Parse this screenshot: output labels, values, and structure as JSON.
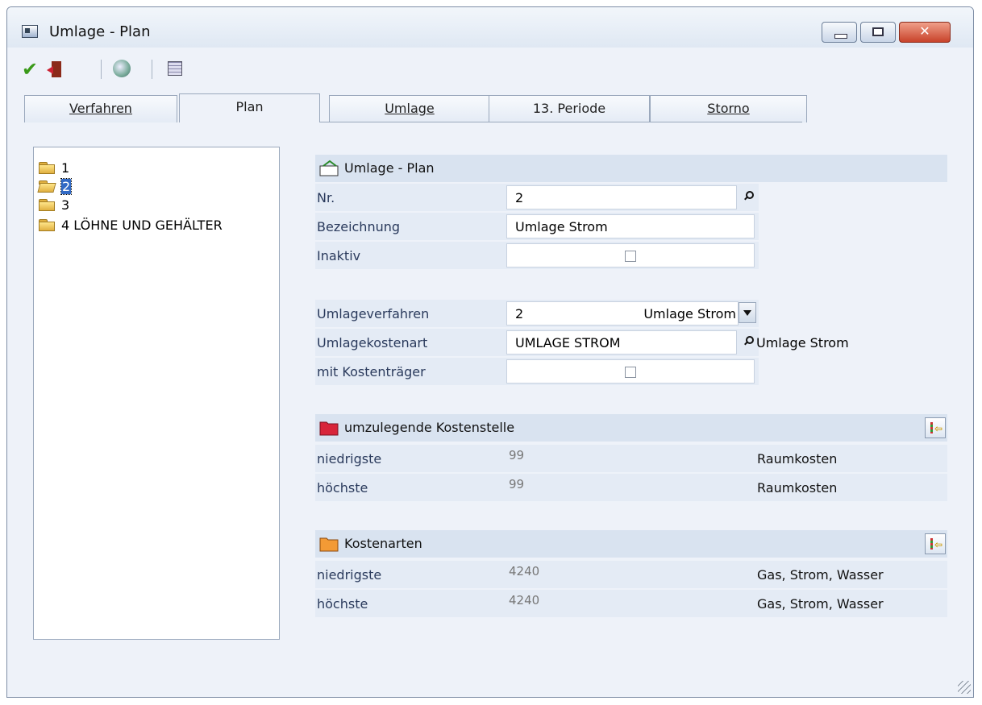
{
  "window": {
    "title": "Umlage - Plan"
  },
  "toolbar": {
    "items": [
      "save-check-icon",
      "exit-door-icon",
      "recycle-icon",
      "report-grid-icon"
    ]
  },
  "tabs": [
    {
      "label": "Verfahren",
      "active": false
    },
    {
      "label": "Plan",
      "active": true
    },
    {
      "label": "Umlage",
      "active": false
    },
    {
      "label": "13. Periode",
      "active": false
    },
    {
      "label": "Storno",
      "active": false
    }
  ],
  "tree": {
    "items": [
      {
        "label": "1",
        "selected": false
      },
      {
        "label": "2",
        "selected": true
      },
      {
        "label": "3",
        "selected": false
      },
      {
        "label": "4 LÖHNE UND GEHÄLTER",
        "selected": false
      }
    ]
  },
  "plan_section": {
    "title": "Umlage - Plan",
    "nr_label": "Nr.",
    "nr_value": "2",
    "bez_label": "Bezeichnung",
    "bez_value": "Umlage Strom",
    "inaktiv_label": "Inaktiv",
    "inaktiv_checked": false,
    "verfahren_label": "Umlageverfahren",
    "verfahren_value": "2",
    "verfahren_text": "Umlage Strom",
    "kostenart_label": "Umlagekostenart",
    "kostenart_value": "UMLAGE STROM",
    "kostenart_desc": "Umlage Strom",
    "kt_label": "mit Kostenträger",
    "kt_checked": false
  },
  "kostenstelle": {
    "title": "umzulegende Kostenstelle",
    "rows": [
      {
        "label": "niedrigste",
        "value": "99",
        "desc": "Raumkosten"
      },
      {
        "label": "höchste",
        "value": "99",
        "desc": "Raumkosten"
      }
    ]
  },
  "kostenarten": {
    "title": "Kostenarten",
    "rows": [
      {
        "label": "niedrigste",
        "value": "4240",
        "desc": "Gas, Strom, Wasser"
      },
      {
        "label": "höchste",
        "value": "4240",
        "desc": "Gas, Strom, Wasser"
      }
    ]
  },
  "colors": {
    "accent": "#316ac5",
    "panel": "#e4ebf5",
    "header": "#d9e3f0"
  }
}
